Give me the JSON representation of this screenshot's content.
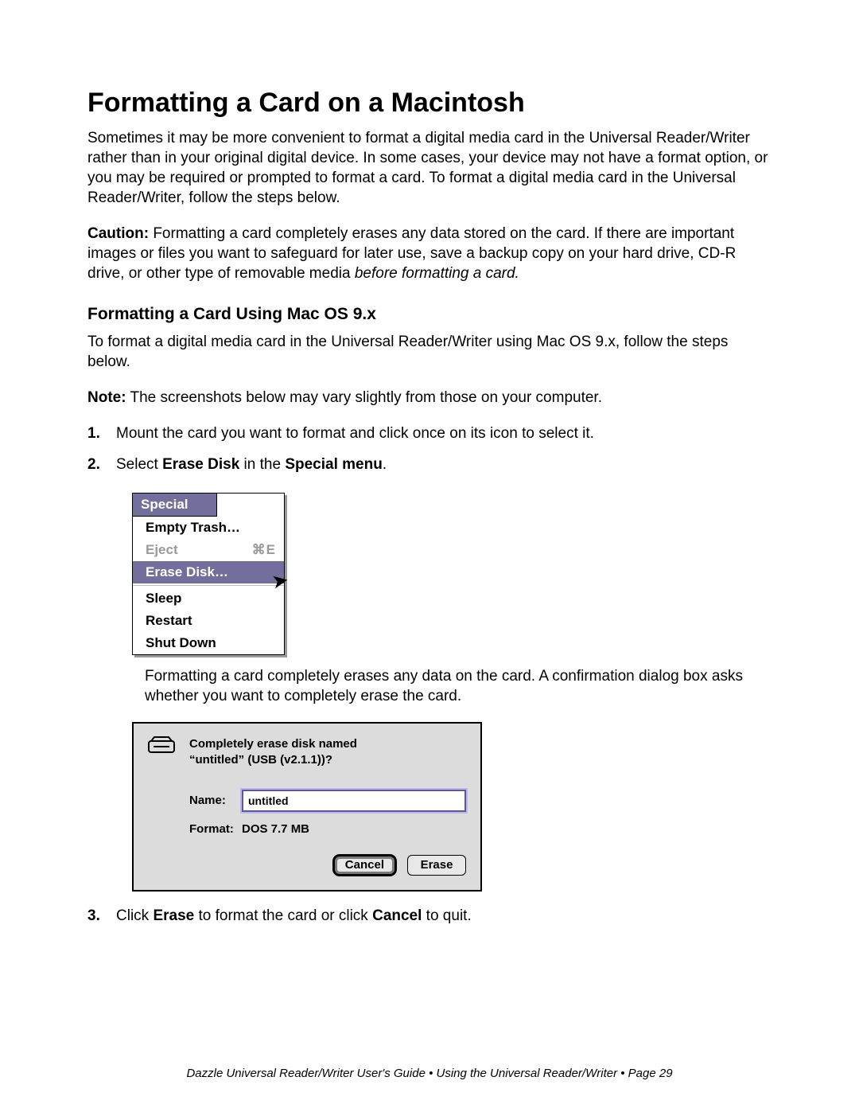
{
  "heading": "Formatting a Card on a Macintosh",
  "intro": "Sometimes it may be more convenient to format a digital media card in the Universal Reader/Writer rather than in your original digital device. In some cases, your device may not have a format option, or you may be required or prompted to format a card. To format a digital media card in the Universal Reader/Writer, follow the steps below.",
  "caution_label": "Caution:",
  "caution_text": " Formatting a card completely erases any data stored on the card. If there are important images or files you want to safeguard for later use, save a backup copy on your hard drive, CD-R drive, or other type of removable media ",
  "caution_em": "before formatting a card.",
  "subheading": "Formatting a  Card Using Mac OS 9.x",
  "sub_intro": "To format a digital media card in the Universal Reader/Writer using Mac OS 9.x, follow the steps below.",
  "note_label": "Note:",
  "note_text": " The screenshots below may vary slightly from those on your computer.",
  "steps": {
    "n1": "1.",
    "s1": "Mount the card you want to format and click once on its icon to select it.",
    "n2": "2.",
    "s2_a": "Select ",
    "s2_b": "Erase Disk",
    "s2_c": " in the ",
    "s2_d": "Special menu",
    "s2_e": ".",
    "n3": "3.",
    "s3_a": "Click ",
    "s3_b": "Erase",
    "s3_c": " to format the card or click ",
    "s3_d": "Cancel",
    "s3_e": " to quit."
  },
  "after_menu": "Formatting a card completely erases any data on the card. A confirmation dialog box asks whether you want to completely erase the card.",
  "menu": {
    "title": "Special",
    "items": {
      "empty": "Empty Trash…",
      "eject": "Eject",
      "eject_shortcut": "⌘E",
      "erase": "Erase Disk…",
      "sleep": "Sleep",
      "restart": "Restart",
      "shutdown": "Shut Down"
    }
  },
  "dialog": {
    "line1": "Completely erase disk named",
    "line2": "“untitled” (USB (v2.1.1))?",
    "name_label": "Name:",
    "name_value": "untitled",
    "format_label": "Format:",
    "format_value": "DOS 7.7 MB",
    "cancel": "Cancel",
    "erase": "Erase"
  },
  "footer": "Dazzle  Universal Reader/Writer User's Guide • Using the Universal Reader/Writer • Page 29"
}
